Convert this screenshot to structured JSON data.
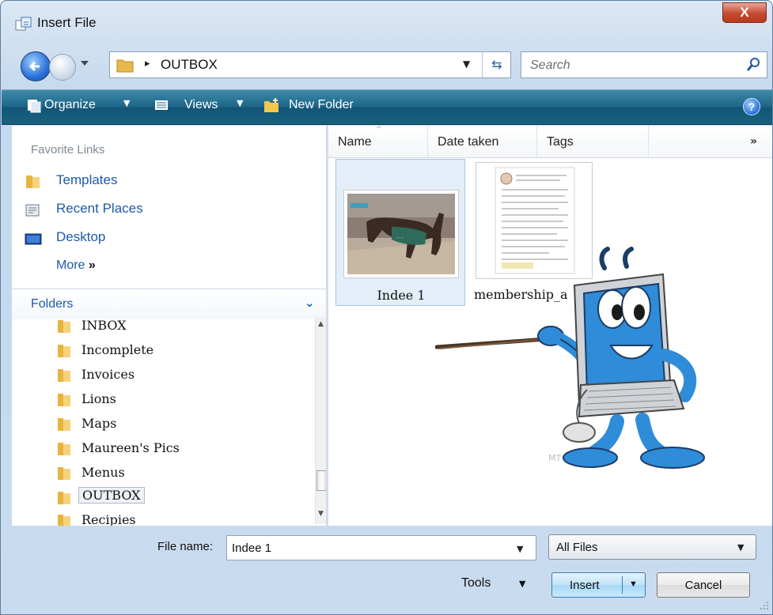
{
  "window": {
    "title": "Insert File",
    "close_label": "X"
  },
  "address_bar": {
    "separator": "▸",
    "current_folder": "OUTBOX"
  },
  "search": {
    "placeholder": "Search"
  },
  "toolbar": {
    "organize": "Organize",
    "views": "Views",
    "new_folder": "New Folder",
    "help": "?"
  },
  "nav": {
    "favorites_title": "Favorite Links",
    "favorites": [
      {
        "label": "Templates",
        "icon": "folder-icon"
      },
      {
        "label": "Recent Places",
        "icon": "recent-places-icon"
      },
      {
        "label": "Desktop",
        "icon": "desktop-icon"
      }
    ],
    "more_label": "More",
    "more_glyph": "»",
    "folders_title": "Folders",
    "folders": [
      "INBOX",
      "Incomplete",
      "Invoices",
      "Lions",
      "Maps",
      "Maureen's Pics",
      "Menus",
      "OUTBOX",
      "Recipies"
    ],
    "selected_folder": "OUTBOX"
  },
  "columns": [
    "Name",
    "Date taken",
    "Tags"
  ],
  "columns_more": "»",
  "files": [
    {
      "name": "Indee 1",
      "selected": true,
      "kind": "photo"
    },
    {
      "name": "membership_a",
      "selected": false,
      "kind": "document"
    }
  ],
  "bottom": {
    "file_name_label": "File name:",
    "file_name_value": "Indee 1",
    "file_type_value": "All Files",
    "tools_label": "Tools",
    "insert_label": "Insert",
    "cancel_label": "Cancel"
  },
  "overlay": {
    "mascot_caption": "MT"
  },
  "colors": {
    "toolbar": "#1d6486",
    "link": "#1e5aa8",
    "selection": "#e3eef9",
    "close": "#c44a2f"
  }
}
